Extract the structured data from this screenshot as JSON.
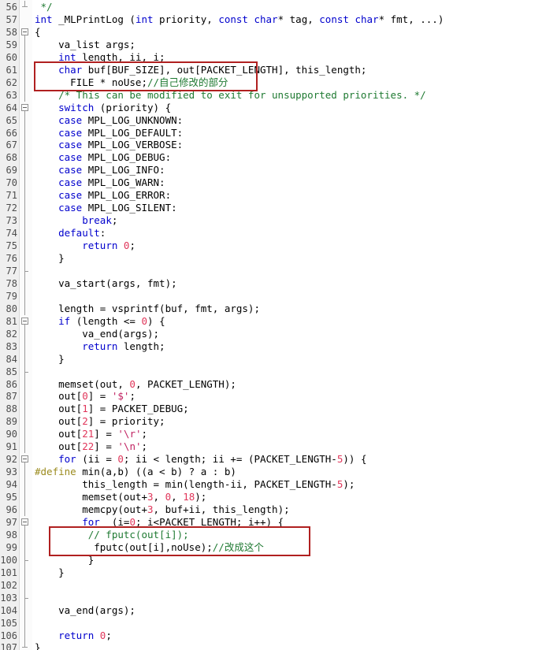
{
  "editor": {
    "language": "c",
    "first_visible_line": 56,
    "last_visible_line": 107,
    "gutter_background": "#efefef",
    "editor_background": "#ffffff",
    "colors": {
      "keyword": "#0000cd",
      "number": "#e0365a",
      "comment": "#1f7a32",
      "preprocessor": "#9b8b1e",
      "string": "#c02060",
      "text": "#000000",
      "annotation": "#b02020"
    }
  },
  "annotations": [
    {
      "name": "red-highlight-box-declaration",
      "color": "#b02020",
      "covers_lines": [
        61,
        62
      ],
      "note": "自己修改的部分"
    },
    {
      "name": "red-highlight-box-fputc",
      "color": "#b02020",
      "covers_lines": [
        98,
        99
      ],
      "note": "改成这个"
    }
  ],
  "lines": [
    {
      "n": "56",
      "fold": "end",
      "tokens": [
        {
          "t": " */",
          "c": "cmt"
        }
      ]
    },
    {
      "n": "57",
      "fold": "none",
      "tokens": [
        {
          "t": "int",
          "c": "kw"
        },
        {
          "t": " _MLPrintLog (",
          "c": "plain"
        },
        {
          "t": "int",
          "c": "kw"
        },
        {
          "t": " priority, ",
          "c": "plain"
        },
        {
          "t": "const",
          "c": "kw"
        },
        {
          "t": " ",
          "c": "plain"
        },
        {
          "t": "char",
          "c": "kw"
        },
        {
          "t": "* tag, ",
          "c": "plain"
        },
        {
          "t": "const",
          "c": "kw"
        },
        {
          "t": " ",
          "c": "plain"
        },
        {
          "t": "char",
          "c": "kw"
        },
        {
          "t": "* fmt, ...)",
          "c": "plain"
        }
      ]
    },
    {
      "n": "58",
      "fold": "open",
      "tokens": [
        {
          "t": "{",
          "c": "plain"
        }
      ]
    },
    {
      "n": "59",
      "fold": "bar",
      "tokens": [
        {
          "t": "    va_list args;",
          "c": "plain"
        }
      ]
    },
    {
      "n": "60",
      "fold": "bar",
      "tokens": [
        {
          "t": "    ",
          "c": "plain"
        },
        {
          "t": "int",
          "c": "kw"
        },
        {
          "t": " length, ii, i;",
          "c": "plain"
        }
      ]
    },
    {
      "n": "61",
      "fold": "bar",
      "tokens": [
        {
          "t": "    ",
          "c": "plain"
        },
        {
          "t": "char",
          "c": "kw"
        },
        {
          "t": " buf[BUF_SIZE], out[PACKET_LENGTH], this_length;",
          "c": "plain"
        }
      ]
    },
    {
      "n": "62",
      "fold": "bar",
      "tokens": [
        {
          "t": "      FILE * noUse;",
          "c": "plain"
        },
        {
          "t": "//自己修改的部分",
          "c": "cmt"
        }
      ]
    },
    {
      "n": "63",
      "fold": "bar",
      "tokens": [
        {
          "t": "    /* This can be modified to exit for unsupported priorities. */",
          "c": "cmt"
        }
      ]
    },
    {
      "n": "64",
      "fold": "open",
      "tokens": [
        {
          "t": "    ",
          "c": "plain"
        },
        {
          "t": "switch",
          "c": "kw"
        },
        {
          "t": " (priority) {",
          "c": "plain"
        }
      ]
    },
    {
      "n": "65",
      "fold": "bar",
      "tokens": [
        {
          "t": "    ",
          "c": "plain"
        },
        {
          "t": "case",
          "c": "kw"
        },
        {
          "t": " MPL_LOG_UNKNOWN:",
          "c": "plain"
        }
      ]
    },
    {
      "n": "66",
      "fold": "bar",
      "tokens": [
        {
          "t": "    ",
          "c": "plain"
        },
        {
          "t": "case",
          "c": "kw"
        },
        {
          "t": " MPL_LOG_DEFAULT:",
          "c": "plain"
        }
      ]
    },
    {
      "n": "67",
      "fold": "bar",
      "tokens": [
        {
          "t": "    ",
          "c": "plain"
        },
        {
          "t": "case",
          "c": "kw"
        },
        {
          "t": " MPL_LOG_VERBOSE:",
          "c": "plain"
        }
      ]
    },
    {
      "n": "68",
      "fold": "bar",
      "tokens": [
        {
          "t": "    ",
          "c": "plain"
        },
        {
          "t": "case",
          "c": "kw"
        },
        {
          "t": " MPL_LOG_DEBUG:",
          "c": "plain"
        }
      ]
    },
    {
      "n": "69",
      "fold": "bar",
      "tokens": [
        {
          "t": "    ",
          "c": "plain"
        },
        {
          "t": "case",
          "c": "kw"
        },
        {
          "t": " MPL_LOG_INFO:",
          "c": "plain"
        }
      ]
    },
    {
      "n": "70",
      "fold": "bar",
      "tokens": [
        {
          "t": "    ",
          "c": "plain"
        },
        {
          "t": "case",
          "c": "kw"
        },
        {
          "t": " MPL_LOG_WARN:",
          "c": "plain"
        }
      ]
    },
    {
      "n": "71",
      "fold": "bar",
      "tokens": [
        {
          "t": "    ",
          "c": "plain"
        },
        {
          "t": "case",
          "c": "kw"
        },
        {
          "t": " MPL_LOG_ERROR:",
          "c": "plain"
        }
      ]
    },
    {
      "n": "72",
      "fold": "bar",
      "tokens": [
        {
          "t": "    ",
          "c": "plain"
        },
        {
          "t": "case",
          "c": "kw"
        },
        {
          "t": " MPL_LOG_SILENT:",
          "c": "plain"
        }
      ]
    },
    {
      "n": "73",
      "fold": "bar",
      "tokens": [
        {
          "t": "        ",
          "c": "plain"
        },
        {
          "t": "break",
          "c": "kw"
        },
        {
          "t": ";",
          "c": "plain"
        }
      ]
    },
    {
      "n": "74",
      "fold": "bar",
      "tokens": [
        {
          "t": "    ",
          "c": "plain"
        },
        {
          "t": "default",
          "c": "kw"
        },
        {
          "t": ":",
          "c": "plain"
        }
      ]
    },
    {
      "n": "75",
      "fold": "bar",
      "tokens": [
        {
          "t": "        ",
          "c": "plain"
        },
        {
          "t": "return",
          "c": "kw"
        },
        {
          "t": " ",
          "c": "plain"
        },
        {
          "t": "0",
          "c": "num"
        },
        {
          "t": ";",
          "c": "plain"
        }
      ]
    },
    {
      "n": "76",
      "fold": "bar",
      "tokens": [
        {
          "t": "    }",
          "c": "plain"
        }
      ]
    },
    {
      "n": "77",
      "fold": "tick",
      "tokens": [
        {
          "t": "",
          "c": "plain"
        }
      ]
    },
    {
      "n": "78",
      "fold": "bar",
      "tokens": [
        {
          "t": "    va_start(args, fmt);",
          "c": "plain"
        }
      ]
    },
    {
      "n": "79",
      "fold": "bar",
      "tokens": [
        {
          "t": "",
          "c": "plain"
        }
      ]
    },
    {
      "n": "80",
      "fold": "bar",
      "tokens": [
        {
          "t": "    length = vsprintf(buf, fmt, args);",
          "c": "plain"
        }
      ]
    },
    {
      "n": "81",
      "fold": "open",
      "tokens": [
        {
          "t": "    ",
          "c": "plain"
        },
        {
          "t": "if",
          "c": "kw"
        },
        {
          "t": " (length <= ",
          "c": "plain"
        },
        {
          "t": "0",
          "c": "num"
        },
        {
          "t": ") {",
          "c": "plain"
        }
      ]
    },
    {
      "n": "82",
      "fold": "bar",
      "tokens": [
        {
          "t": "        va_end(args);",
          "c": "plain"
        }
      ]
    },
    {
      "n": "83",
      "fold": "bar",
      "tokens": [
        {
          "t": "        ",
          "c": "plain"
        },
        {
          "t": "return",
          "c": "kw"
        },
        {
          "t": " length;",
          "c": "plain"
        }
      ]
    },
    {
      "n": "84",
      "fold": "bar",
      "tokens": [
        {
          "t": "    }",
          "c": "plain"
        }
      ]
    },
    {
      "n": "85",
      "fold": "tick",
      "tokens": [
        {
          "t": "",
          "c": "plain"
        }
      ]
    },
    {
      "n": "86",
      "fold": "bar",
      "tokens": [
        {
          "t": "    memset(out, ",
          "c": "plain"
        },
        {
          "t": "0",
          "c": "num"
        },
        {
          "t": ", PACKET_LENGTH);",
          "c": "plain"
        }
      ]
    },
    {
      "n": "87",
      "fold": "bar",
      "tokens": [
        {
          "t": "    out[",
          "c": "plain"
        },
        {
          "t": "0",
          "c": "num"
        },
        {
          "t": "] = ",
          "c": "plain"
        },
        {
          "t": "'$'",
          "c": "str"
        },
        {
          "t": ";",
          "c": "plain"
        }
      ]
    },
    {
      "n": "88",
      "fold": "bar",
      "tokens": [
        {
          "t": "    out[",
          "c": "plain"
        },
        {
          "t": "1",
          "c": "num"
        },
        {
          "t": "] = PACKET_DEBUG;",
          "c": "plain"
        }
      ]
    },
    {
      "n": "89",
      "fold": "bar",
      "tokens": [
        {
          "t": "    out[",
          "c": "plain"
        },
        {
          "t": "2",
          "c": "num"
        },
        {
          "t": "] = priority;",
          "c": "plain"
        }
      ]
    },
    {
      "n": "90",
      "fold": "bar",
      "tokens": [
        {
          "t": "    out[",
          "c": "plain"
        },
        {
          "t": "21",
          "c": "num"
        },
        {
          "t": "] = ",
          "c": "plain"
        },
        {
          "t": "'\\r'",
          "c": "str"
        },
        {
          "t": ";",
          "c": "plain"
        }
      ]
    },
    {
      "n": "91",
      "fold": "bar",
      "tokens": [
        {
          "t": "    out[",
          "c": "plain"
        },
        {
          "t": "22",
          "c": "num"
        },
        {
          "t": "] = ",
          "c": "plain"
        },
        {
          "t": "'\\n'",
          "c": "str"
        },
        {
          "t": ";",
          "c": "plain"
        }
      ]
    },
    {
      "n": "92",
      "fold": "open",
      "tokens": [
        {
          "t": "    ",
          "c": "plain"
        },
        {
          "t": "for",
          "c": "kw"
        },
        {
          "t": " (ii = ",
          "c": "plain"
        },
        {
          "t": "0",
          "c": "num"
        },
        {
          "t": "; ii < length; ii += (PACKET_LENGTH-",
          "c": "plain"
        },
        {
          "t": "5",
          "c": "num"
        },
        {
          "t": ")) {",
          "c": "plain"
        }
      ]
    },
    {
      "n": "93",
      "fold": "bar",
      "tokens": [
        {
          "t": "#define",
          "c": "pre"
        },
        {
          "t": " min(a,b) ((a < b) ? a : b)",
          "c": "plain"
        }
      ]
    },
    {
      "n": "94",
      "fold": "bar",
      "tokens": [
        {
          "t": "        this_length = min(length-ii, PACKET_LENGTH-",
          "c": "plain"
        },
        {
          "t": "5",
          "c": "num"
        },
        {
          "t": ");",
          "c": "plain"
        }
      ]
    },
    {
      "n": "95",
      "fold": "bar",
      "tokens": [
        {
          "t": "        memset(out+",
          "c": "plain"
        },
        {
          "t": "3",
          "c": "num"
        },
        {
          "t": ", ",
          "c": "plain"
        },
        {
          "t": "0",
          "c": "num"
        },
        {
          "t": ", ",
          "c": "plain"
        },
        {
          "t": "18",
          "c": "num"
        },
        {
          "t": ");",
          "c": "plain"
        }
      ]
    },
    {
      "n": "96",
      "fold": "bar",
      "tokens": [
        {
          "t": "        memcpy(out+",
          "c": "plain"
        },
        {
          "t": "3",
          "c": "num"
        },
        {
          "t": ", buf+ii, this_length);",
          "c": "plain"
        }
      ]
    },
    {
      "n": "97",
      "fold": "open",
      "tokens": [
        {
          "t": "        ",
          "c": "plain"
        },
        {
          "t": "for",
          "c": "kw"
        },
        {
          "t": "  (i=",
          "c": "plain"
        },
        {
          "t": "0",
          "c": "num"
        },
        {
          "t": "; i<PACKET_LENGTH; i++) {",
          "c": "plain"
        }
      ]
    },
    {
      "n": "98",
      "fold": "bar",
      "tokens": [
        {
          "t": "         // fputc(out[i]);",
          "c": "cmt"
        }
      ]
    },
    {
      "n": "99",
      "fold": "bar",
      "tokens": [
        {
          "t": "          fputc(out[i],noUse);",
          "c": "plain"
        },
        {
          "t": "//改成这个",
          "c": "cmt"
        }
      ]
    },
    {
      "n": "100",
      "fold": "tick",
      "tokens": [
        {
          "t": "         }",
          "c": "plain"
        }
      ]
    },
    {
      "n": "101",
      "fold": "bar",
      "tokens": [
        {
          "t": "    }",
          "c": "plain"
        }
      ]
    },
    {
      "n": "102",
      "fold": "bar",
      "tokens": [
        {
          "t": "",
          "c": "plain"
        }
      ]
    },
    {
      "n": "103",
      "fold": "tick",
      "tokens": [
        {
          "t": "",
          "c": "plain"
        }
      ]
    },
    {
      "n": "104",
      "fold": "bar",
      "tokens": [
        {
          "t": "    va_end(args);",
          "c": "plain"
        }
      ]
    },
    {
      "n": "105",
      "fold": "bar",
      "tokens": [
        {
          "t": "",
          "c": "plain"
        }
      ]
    },
    {
      "n": "106",
      "fold": "bar",
      "tokens": [
        {
          "t": "    ",
          "c": "plain"
        },
        {
          "t": "return",
          "c": "kw"
        },
        {
          "t": " ",
          "c": "plain"
        },
        {
          "t": "0",
          "c": "num"
        },
        {
          "t": ";",
          "c": "plain"
        }
      ]
    },
    {
      "n": "107",
      "fold": "end",
      "tokens": [
        {
          "t": "}",
          "c": "plain"
        }
      ]
    }
  ]
}
